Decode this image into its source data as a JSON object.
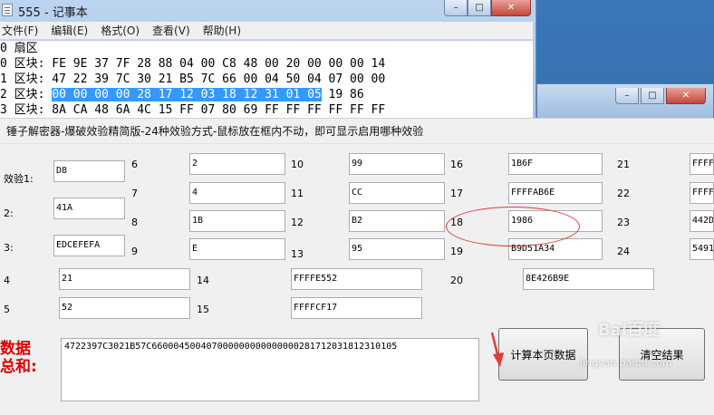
{
  "notepad": {
    "title": "555 - 记事本",
    "menu": [
      "文件(F)",
      "编辑(E)",
      "格式(O)",
      "查看(V)",
      "帮助(H)"
    ],
    "lines": [
      {
        "prefix": "0 扇区",
        "hl": "",
        "suffix": ""
      },
      {
        "prefix": "0 区块: FE 9E 37 7F 28 88 04 00 C8 48 00 20 00 00 00 14",
        "hl": "",
        "suffix": ""
      },
      {
        "prefix": "1 区块: 47 22 39 7C 30 21 B5 7C 66 00 04 50 04 07 00 00",
        "hl": "",
        "suffix": ""
      },
      {
        "prefix": "2 区块: ",
        "hl": "00 00 00 00 28 17 12 03 18 12 31 01 05",
        "suffix": " 19 86"
      },
      {
        "prefix": "3 区块: 8A CA 48 6A 4C 15 FF 07 80 69 FF FF FF FF FF FF",
        "hl": "",
        "suffix": ""
      }
    ]
  },
  "tool": {
    "title": "锤子解密器-爆破效验精简版-24种效验方式-鼠标放在框内不动，即可显示启用哪种效验",
    "row_labels": {
      "r1": "效验1:",
      "r2": "2:",
      "r3": "3:",
      "r4": "4",
      "r5": "5"
    },
    "cells": {
      "c1": "D8",
      "c2": "41A",
      "c3": "EDCEFEFA",
      "c4": "21",
      "c5": "52",
      "c6": "2",
      "c7": "4",
      "c8": "1B",
      "c9": "E",
      "c10": "99",
      "c11": "CC",
      "c12": "B2",
      "c13": "95",
      "c14": "FFFFE552",
      "c15": "FFFFCF17",
      "c16": "1B6F",
      "c17": "FFFFAB6E",
      "c18": "1986",
      "c19": "B9D51A34",
      "c20": "8E426B9E",
      "c21": "FFFF",
      "c22": "FFFF",
      "c23": "442D",
      "c24": "5491"
    },
    "num_labels": {
      "n6": "6",
      "n7": "7",
      "n8": "8",
      "n9": "9",
      "n10": "10",
      "n11": "11",
      "n12": "12",
      "n13": "13",
      "n14": "14",
      "n15": "15",
      "n16": "16",
      "n17": "17",
      "n18": "18",
      "n19": "19",
      "n20": "20",
      "n21": "21",
      "n22": "22",
      "n23": "23",
      "n24": "24"
    },
    "sum_label": "数据总和:",
    "sum_value": "4722397C3021B57C660004500407000000000000000281712031812310105",
    "btn_calc": "计算本页数据",
    "btn_clear": "清空结果"
  },
  "watermark": {
    "brand": "Bai百度",
    "site": "jingyan.baidu.com"
  },
  "colors": {
    "highlight": "#3399ff",
    "annotation": "#e23b3b",
    "sum_label": "#e00000"
  }
}
